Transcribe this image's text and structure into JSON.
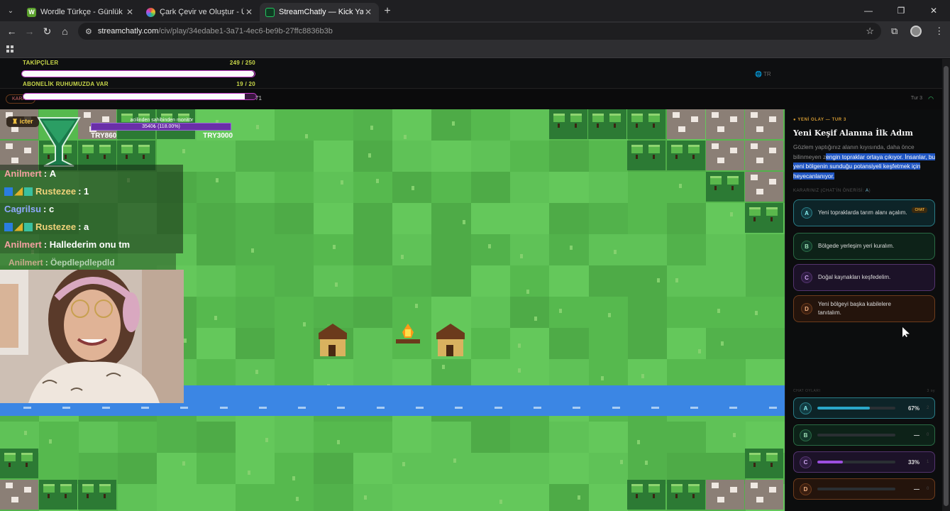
{
  "browser": {
    "tabs": [
      {
        "title": "Wordle Türkçe - Günlük Kelime",
        "fav": "W",
        "fav_color": "#5aa02c",
        "active": false
      },
      {
        "title": "Çark Çevir ve Oluştur - Ücretsiz",
        "fav": "",
        "fav_color": "#e04a8a",
        "active": false
      },
      {
        "title": "StreamChatly — Kick Yayıncıları",
        "fav": "",
        "fav_color": "#22c55e",
        "active": true
      }
    ],
    "url_host": "streamchatly.com",
    "url_path": "/civ/play/34edabe1-3a71-4ec6-be9b-27ffc8836b3b"
  },
  "overlay": {
    "followers_label": "TAKİPÇİLER",
    "followers_value": "249 / 250",
    "followers_fraction": 0.996,
    "subs_label": "ABONELİK RUHUMUZDA VAR",
    "subs_value": "19 / 20",
    "subs_fraction": 0.95,
    "lang": "TR",
    "pill": "KARAR",
    "sub_count": "71",
    "turn_mini": "Tur 3"
  },
  "stream": {
    "icter_label": "icter",
    "donate_label": "acilinden sahibinden monitör",
    "donate_progress": "3540₺ (118.00%)",
    "donate_left": "TRY860",
    "donate_right": "TRY3000",
    "chat": [
      {
        "user": "Anilmert",
        "color": "#f3a1a1",
        "badges": false,
        "msg": "A"
      },
      {
        "user": "Rustezee",
        "color": "#f0d27a",
        "badges": true,
        "msg": "1"
      },
      {
        "user": "Cagrilsu",
        "color": "#8fa8ff",
        "badges": false,
        "msg": "c"
      },
      {
        "user": "Rustezee",
        "color": "#f0d27a",
        "badges": true,
        "msg": "a"
      },
      {
        "user": "Anilmert",
        "color": "#f3a1a1",
        "badges": false,
        "msg": "Hallederim onu tm"
      },
      {
        "user": "Anilmert",
        "color": "#f3a1a1",
        "badges": false,
        "msg": "Öepdlepdlepdld"
      }
    ]
  },
  "event": {
    "tag": "YENİ OLAY — TUR 3",
    "title": "Yeni Keşif Alanına İlk Adım",
    "body_plain": "Gözlem yaptığınız alanın kıyısında, daha önce bilinmeyen z",
    "body_highlight": "engin topraklar ortaya çıkıyor. İnsanlar, bu yeni bölgenin sunduğu potansiyeli keşfetmek için heyecanlanıyor.",
    "karar_label": "KARARINIZ (CHAT'İN ÖNERİSİ: ",
    "karar_choice": "A",
    "karar_close": ")",
    "options": [
      {
        "letter": "A",
        "text": "Yeni topraklarda tarım alanı açalım.",
        "chat_badge": "CHAT"
      },
      {
        "letter": "B",
        "text": "Bölgede yerleşim yeri kuralım.",
        "chat_badge": ""
      },
      {
        "letter": "C",
        "text": "Doğal kaynakları keşfedelim.",
        "chat_badge": ""
      },
      {
        "letter": "D",
        "text": "Yeni bölgeyi başka kabilelere tanıtalım.",
        "chat_badge": ""
      }
    ]
  },
  "votes": {
    "header": "CHAT OYLARI",
    "total": "3 oy",
    "rows": [
      {
        "letter": "A",
        "pct": "67%",
        "fraction": 0.67,
        "count": "2",
        "color": "#2aa7c9"
      },
      {
        "letter": "B",
        "pct": "—",
        "fraction": 0,
        "count": "0",
        "color": "#2fb36a"
      },
      {
        "letter": "C",
        "pct": "33%",
        "fraction": 0.33,
        "count": "1",
        "color": "#9d4fe0"
      },
      {
        "letter": "D",
        "pct": "—",
        "fraction": 0,
        "count": "0",
        "color": "#e07a3a"
      }
    ]
  }
}
